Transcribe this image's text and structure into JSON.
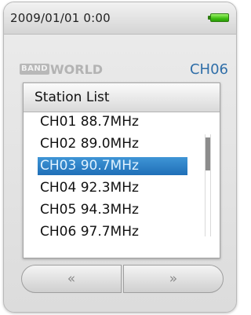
{
  "status_bar": {
    "datetime": "2009/01/01   0:00",
    "battery_icon": "battery-full-icon",
    "battery_color": "#3fbf12"
  },
  "band": {
    "badge": "BAND",
    "name": "WORLD",
    "channel": "CH06",
    "channel_color": "#2f6ea8"
  },
  "dialog": {
    "title": "Station List",
    "stations": [
      {
        "label": "CH01 88.7MHz",
        "selected": false
      },
      {
        "label": "CH02 89.0MHz",
        "selected": false
      },
      {
        "label": "CH03 90.7MHz",
        "selected": true
      },
      {
        "label": "CH04 92.3MHz",
        "selected": false
      },
      {
        "label": "CH05 94.3MHz",
        "selected": false
      },
      {
        "label": "CH06 97.7MHz",
        "selected": false
      }
    ],
    "selection_color": "#1f6fb7"
  },
  "buttons": {
    "prev_label": "«",
    "next_label": "»"
  }
}
